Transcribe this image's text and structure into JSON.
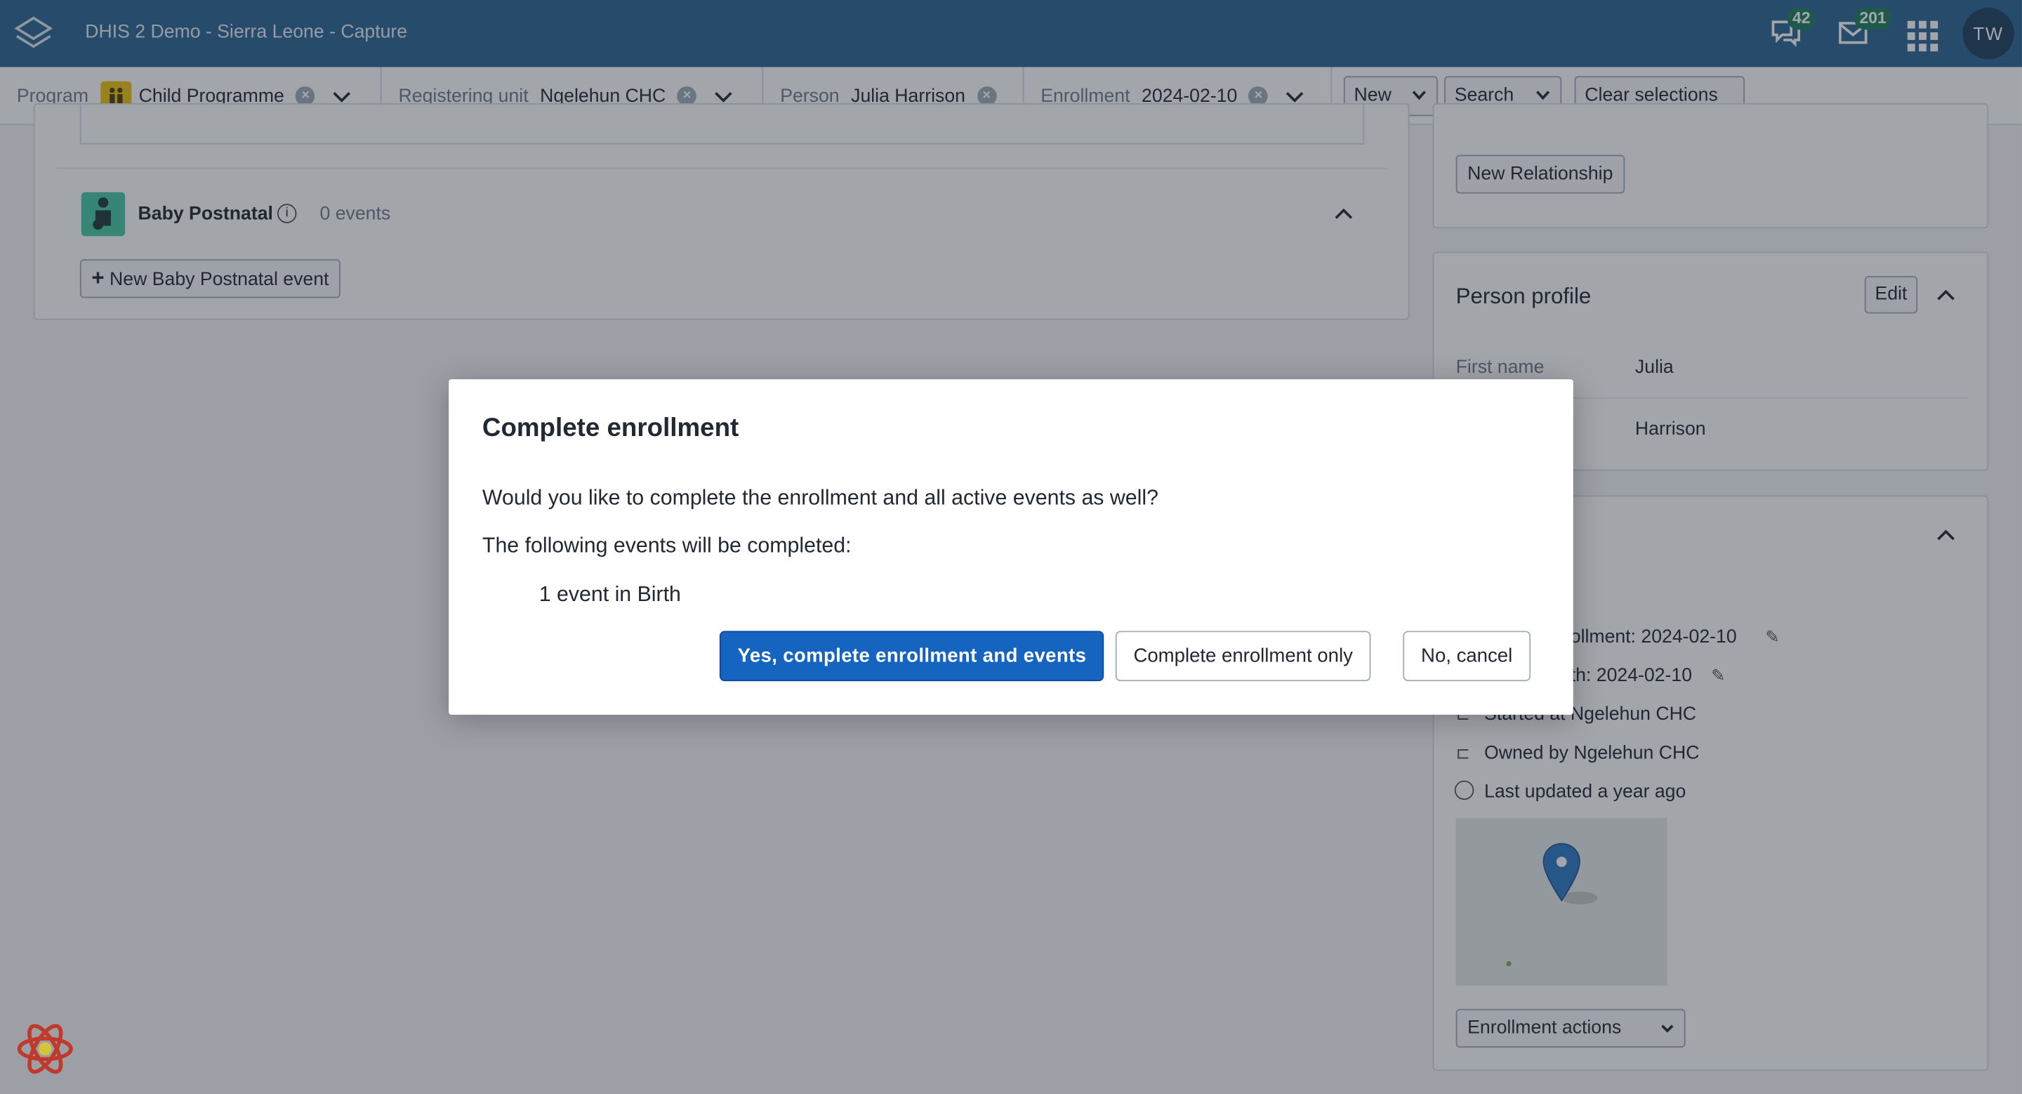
{
  "header": {
    "app_title": "DHIS 2 Demo - Sierra Leone - Capture",
    "interpretations_count": "42",
    "messages_count": "201",
    "avatar_initials": "TW",
    "icons": [
      "dhis2-logo-icon",
      "interpretations-icon",
      "messages-icon",
      "apps-grid-icon"
    ]
  },
  "context_bar": {
    "program_label": "Program",
    "program_value": "Child Programme",
    "org_unit_label": "Registering unit",
    "org_unit_value": "Ngelehun CHC",
    "person_label": "Person",
    "person_value": "Julia Harrison",
    "enrollment_label": "Enrollment",
    "enrollment_value": "2024-02-10",
    "new_label": "New",
    "search_label": "Search",
    "clear_label": "Clear selections"
  },
  "stages": {
    "stage_name": "Baby Postnatal",
    "stage_count": "0 events",
    "new_event_label": "New Baby Postnatal event"
  },
  "sidebar": {
    "new_relationship_label": "New Relationship",
    "profile_title": "Person profile",
    "edit_label": "Edit",
    "first_name_label": "First name",
    "first_name_value": "Julia",
    "last_name_value": "Harrison",
    "enrollment_date_partial": "rollment: 2024-02-10",
    "birth_date_partial": "rth: 2024-02-10",
    "started_at": "Started at Ngelehun CHC",
    "owned_by": "Owned by Ngelehun CHC",
    "last_updated": "Last updated a year ago",
    "enrollment_actions_label": "Enrollment actions"
  },
  "modal": {
    "title": "Complete enrollment",
    "question": "Would you like to complete the enrollment and all active events as well?",
    "following": "The following events will be completed:",
    "event_item": "1 event in Birth",
    "primary_label": "Yes, complete enrollment and events",
    "secondary_label": "Complete enrollment only",
    "cancel_label": "No, cancel"
  },
  "colors": {
    "header_bg": "#2c6693",
    "primary_button": "#1565c0",
    "badge": "#1d7f5e",
    "program_icon": "#f0c20b",
    "stage_icon": "#48c9a3"
  }
}
